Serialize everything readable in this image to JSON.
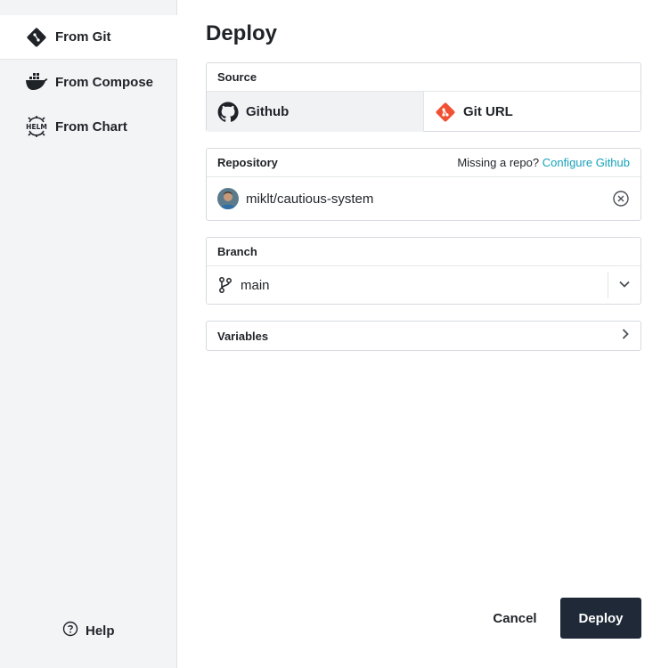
{
  "sidebar": {
    "items": [
      {
        "label": "From Git",
        "icon": "git-icon",
        "active": true
      },
      {
        "label": "From Compose",
        "icon": "docker-icon",
        "active": false
      },
      {
        "label": "From Chart",
        "icon": "helm-icon",
        "active": false
      }
    ],
    "help_label": "Help"
  },
  "main": {
    "title": "Deploy",
    "source": {
      "heading": "Source",
      "tabs": [
        {
          "label": "Github",
          "icon": "github-icon",
          "active": true
        },
        {
          "label": "Git URL",
          "icon": "git-url-icon",
          "active": false
        }
      ]
    },
    "repository": {
      "heading": "Repository",
      "missing_text": "Missing a repo?",
      "configure_link": "Configure Github",
      "selected": "miklt/cautious-system"
    },
    "branch": {
      "heading": "Branch",
      "selected": "main"
    },
    "variables": {
      "heading": "Variables"
    }
  },
  "footer": {
    "cancel_label": "Cancel",
    "deploy_label": "Deploy"
  },
  "colors": {
    "accent_link": "#17a2b8",
    "primary_button": "#1f2937",
    "git_orange": "#f05133"
  }
}
